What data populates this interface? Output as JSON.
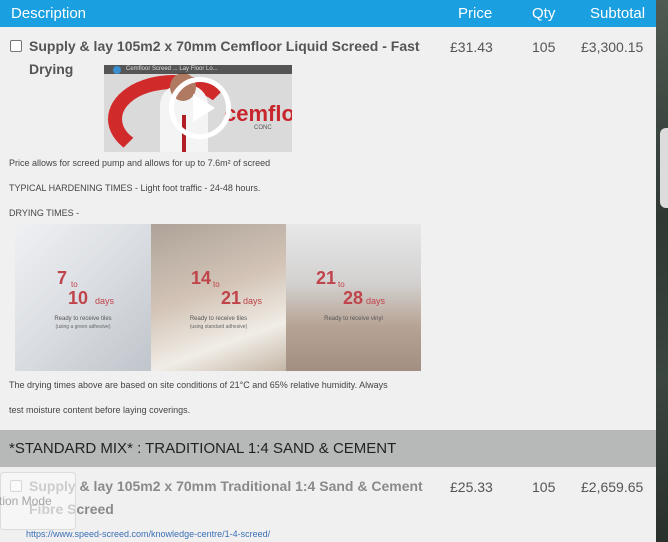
{
  "header": {
    "description": "Description",
    "price": "Price",
    "qty": "Qty",
    "subtotal": "Subtotal"
  },
  "item1": {
    "title_line1": "Supply & lay 105m2 x 70mm Cemfloor Liquid Screed - Fast",
    "title_line2": "Drying",
    "price": "£31.43",
    "qty": "105",
    "subtotal": "£3,300.15",
    "video": {
      "bar_title": "Cemfloor Screed ... Lay Floor Lo...",
      "logo": "cemfloor",
      "logo_sub": "CONC",
      "icon": "play-icon"
    },
    "note": "Price allows for screed pump and allows for up to 7.6m² of screed",
    "hardening": "TYPICAL HARDENING TIMES - Light foot traffic - 24-48 hours.",
    "drying_label": "DRYING TIMES -",
    "drying": [
      {
        "from": "7",
        "to_word": "to",
        "to": "10",
        "unit": "days",
        "ready": "Ready to receive tiles",
        "note": "(using a green adhesive)"
      },
      {
        "from": "14",
        "to_word": "to",
        "to": "21",
        "unit": "days",
        "ready": "Ready to receive tiles",
        "note": "(using standard adhesive)"
      },
      {
        "from": "21",
        "to_word": "to",
        "to": "28",
        "unit": "days",
        "ready": "Ready to receive vinyl",
        "note": ""
      }
    ],
    "conditions_1": "The drying times above are based on site conditions of 21°C and 65% relative humidity.  Always",
    "conditions_2": "test moisture content before laying coverings."
  },
  "section": {
    "title": "*STANDARD MIX* : TRADITIONAL 1:4 SAND & CEMENT"
  },
  "item2": {
    "title_line1": "Supply & lay 105m2 x 70mm Traditional 1:4 Sand & Cement",
    "title_line2": "Fibre Screed",
    "price": "£25.33",
    "qty": "105",
    "subtotal": "£2,659.65",
    "link": "https://www.speed-screed.com/knowledge-centre/1-4-screed/"
  },
  "overlay": {
    "mode_label": "tion Mode"
  },
  "colors": {
    "header_bg": "#1a9fe0",
    "section_bg": "#b7b9b9",
    "accent_red": "#c0444b"
  }
}
